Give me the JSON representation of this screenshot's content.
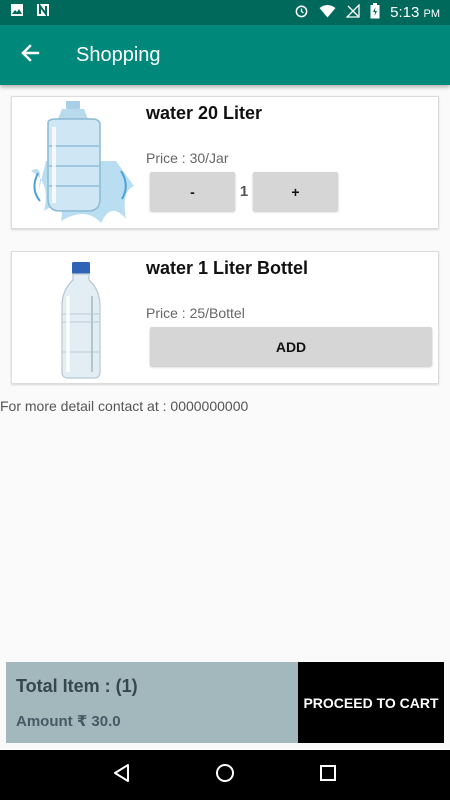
{
  "status_bar": {
    "time": "5:13",
    "ampm": "PM",
    "icons": [
      "image-icon",
      "n-icon",
      "alarm-icon",
      "wifi-icon",
      "signal-icon",
      "battery-icon"
    ]
  },
  "app_bar": {
    "title": "Shopping",
    "back_icon": "arrow-back-icon"
  },
  "products": [
    {
      "name": "water 20 Liter",
      "price": "Price : 30/Jar",
      "quantity": "1",
      "minus_label": "-",
      "plus_label": "+",
      "image": "water-jar-image"
    },
    {
      "name": "water 1 Liter Bottel",
      "price": "Price : 25/Bottel",
      "add_label": "ADD",
      "image": "water-bottle-image"
    }
  ],
  "contact_text": "For more detail contact at : 0000000000",
  "cart_summary": {
    "total_item": "Total Item : (1)",
    "amount": "Amount ₹ 30.0",
    "proceed_label": "PROCEED TO CART"
  },
  "colors": {
    "status_bar": "#00695c",
    "app_bar": "#00897b",
    "summary_bg": "#a3b8bd",
    "proceed_bg": "#000000"
  }
}
